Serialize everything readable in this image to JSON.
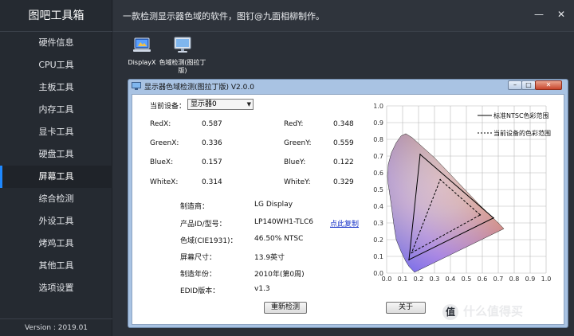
{
  "app": {
    "title": "图吧工具箱",
    "version": "Version : 2019.01"
  },
  "sidebar": {
    "items": [
      {
        "label": "硬件信息"
      },
      {
        "label": "CPU工具"
      },
      {
        "label": "主板工具"
      },
      {
        "label": "内存工具"
      },
      {
        "label": "显卡工具"
      },
      {
        "label": "硬盘工具"
      },
      {
        "label": "屏幕工具",
        "active": true
      },
      {
        "label": "综合检测"
      },
      {
        "label": "外设工具"
      },
      {
        "label": "烤鸡工具"
      },
      {
        "label": "其他工具"
      },
      {
        "label": "选项设置"
      }
    ]
  },
  "topbar": {
    "description": "一款检测显示器色域的软件，图钉@九面相柳制作。",
    "minimize_glyph": "—",
    "close_glyph": "✕"
  },
  "desktop_icons": [
    {
      "label": "DisplayX",
      "icon": "laptop-display-icon"
    },
    {
      "label": "色域检测(图拉丁版)",
      "icon": "monitor-icon"
    }
  ],
  "dialog": {
    "title": "显示器色域检测(图拉丁版) V2.0.0",
    "current_device_label": "当前设备：",
    "device_selected": "显示器0",
    "chroma": {
      "redx_label": "RedX:",
      "redx": "0.587",
      "redy_label": "RedY:",
      "redy": "0.348",
      "greenx_label": "GreenX:",
      "greenx": "0.336",
      "greeny_label": "GreenY:",
      "greeny": "0.559",
      "bluex_label": "BlueX:",
      "bluex": "0.157",
      "bluey_label": "BlueY:",
      "bluey": "0.122",
      "whitex_label": "WhiteX:",
      "whitex": "0.314",
      "whitey_label": "WhiteY:",
      "whitey": "0.329"
    },
    "info": {
      "manufacturer_label": "制造商：",
      "manufacturer": "LG Display",
      "model_label": "产品ID/型号：",
      "model": "LP140WH1-TLC6",
      "copy_link": "点此复制",
      "gamut_label": "色域(CIE1931)：",
      "gamut": "46.50% NTSC",
      "size_label": "屏幕尺寸：",
      "size": "13.9英寸",
      "year_label": "制造年份：",
      "year": "2010年(第0周)",
      "edid_label": "EDID版本：",
      "edid": "v1.3"
    },
    "buttons": {
      "redetect": "重新检测",
      "about": "关于"
    }
  },
  "chart_data": {
    "type": "scatter",
    "title": "",
    "xlim": [
      0.0,
      1.0
    ],
    "ylim": [
      0.0,
      1.0
    ],
    "x_ticks": [
      "0.0",
      "0.1",
      "0.2",
      "0.3",
      "0.4",
      "0.5",
      "0.6",
      "0.7",
      "0.8",
      "0.9",
      "1.0"
    ],
    "y_ticks": [
      "0.0",
      "0.1",
      "0.2",
      "0.3",
      "0.4",
      "0.5",
      "0.6",
      "0.7",
      "0.8",
      "0.9",
      "1.0"
    ],
    "grid": true,
    "legend": [
      {
        "label": "标准NTSC色彩范围",
        "style": "solid"
      },
      {
        "label": "当前设备的色彩范围",
        "style": "dashed"
      }
    ],
    "series": [
      {
        "name": "标准NTSC色彩范围",
        "points": [
          [
            0.67,
            0.33
          ],
          [
            0.21,
            0.71
          ],
          [
            0.14,
            0.08
          ]
        ]
      },
      {
        "name": "当前设备的色彩范围",
        "points": [
          [
            0.587,
            0.348
          ],
          [
            0.336,
            0.559
          ],
          [
            0.157,
            0.122
          ]
        ]
      }
    ],
    "white_point": [
      0.314,
      0.329
    ],
    "locus": [
      [
        0.175,
        0.005
      ],
      [
        0.174,
        0.005
      ],
      [
        0.17,
        0.01
      ],
      [
        0.16,
        0.02
      ],
      [
        0.14,
        0.04
      ],
      [
        0.12,
        0.07
      ],
      [
        0.09,
        0.13
      ],
      [
        0.06,
        0.2
      ],
      [
        0.045,
        0.29
      ],
      [
        0.03,
        0.4
      ],
      [
        0.015,
        0.5
      ],
      [
        0.008,
        0.54
      ],
      [
        0.005,
        0.58
      ],
      [
        0.01,
        0.65
      ],
      [
        0.03,
        0.72
      ],
      [
        0.06,
        0.78
      ],
      [
        0.09,
        0.82
      ],
      [
        0.12,
        0.834
      ],
      [
        0.16,
        0.81
      ],
      [
        0.23,
        0.75
      ],
      [
        0.3,
        0.69
      ],
      [
        0.37,
        0.62
      ],
      [
        0.44,
        0.55
      ],
      [
        0.51,
        0.48
      ],
      [
        0.58,
        0.41
      ],
      [
        0.64,
        0.355
      ],
      [
        0.7,
        0.3
      ],
      [
        0.735,
        0.265
      ],
      [
        0.175,
        0.005
      ]
    ],
    "colors": {
      "locus_edge": "#000000",
      "grid": "#b8b8b8"
    }
  }
}
